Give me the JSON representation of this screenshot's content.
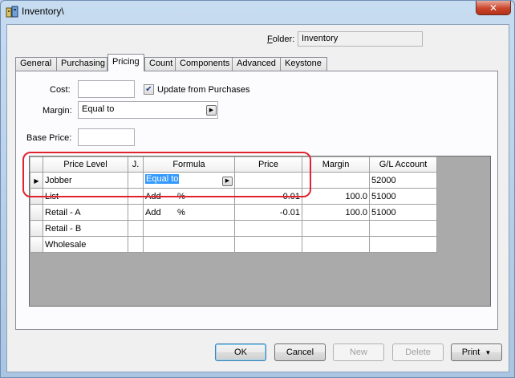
{
  "window": {
    "title": "Inventory\\",
    "close_glyph": "✕"
  },
  "folder": {
    "label_prefix": "F",
    "label_rest": "older:",
    "value": "Inventory"
  },
  "tabs": [
    {
      "label": "General",
      "active": false
    },
    {
      "label": "Purchasing",
      "active": false
    },
    {
      "label": "Pricing",
      "active": true
    },
    {
      "label": "Count",
      "active": false
    },
    {
      "label": "Components",
      "active": false
    },
    {
      "label": "Advanced",
      "active": false
    },
    {
      "label": "Keystone",
      "active": false
    }
  ],
  "pricing": {
    "cost_label": "Cost:",
    "cost_value": "",
    "update_label": "Update from Purchases",
    "update_checked": true,
    "margin_label": "Margin:",
    "margin_value": "Equal to",
    "base_price_label": "Base Price:",
    "base_price_value": ""
  },
  "grid": {
    "columns": [
      "Price Level",
      "J.",
      "Formula",
      "Price",
      "Margin",
      "G/L Account"
    ],
    "rows": [
      {
        "level": "Jobber",
        "j": "",
        "formula": "Equal to",
        "formula_sym": "",
        "price": "",
        "margin": "",
        "account": "52000",
        "current": true
      },
      {
        "level": "List",
        "j": "",
        "formula": "Add",
        "formula_sym": "%",
        "price": "-0.01",
        "margin": "100.0",
        "account": "51000",
        "current": false
      },
      {
        "level": "Retail - A",
        "j": "",
        "formula": "Add",
        "formula_sym": "%",
        "price": "-0.01",
        "margin": "100.0",
        "account": "51000",
        "current": false
      },
      {
        "level": "Retail - B",
        "j": "",
        "formula": "",
        "formula_sym": "",
        "price": "",
        "margin": "",
        "account": "",
        "current": false
      },
      {
        "level": "Wholesale",
        "j": "",
        "formula": "",
        "formula_sym": "",
        "price": "",
        "margin": "",
        "account": "",
        "current": false
      }
    ]
  },
  "buttons": {
    "ok": "OK",
    "cancel": "Cancel",
    "new": "New",
    "delete": "Delete",
    "print": "Print",
    "print_arrow": "▼"
  },
  "colors": {
    "annotation_ring": "#e0232f",
    "selection": "#3399ff"
  }
}
